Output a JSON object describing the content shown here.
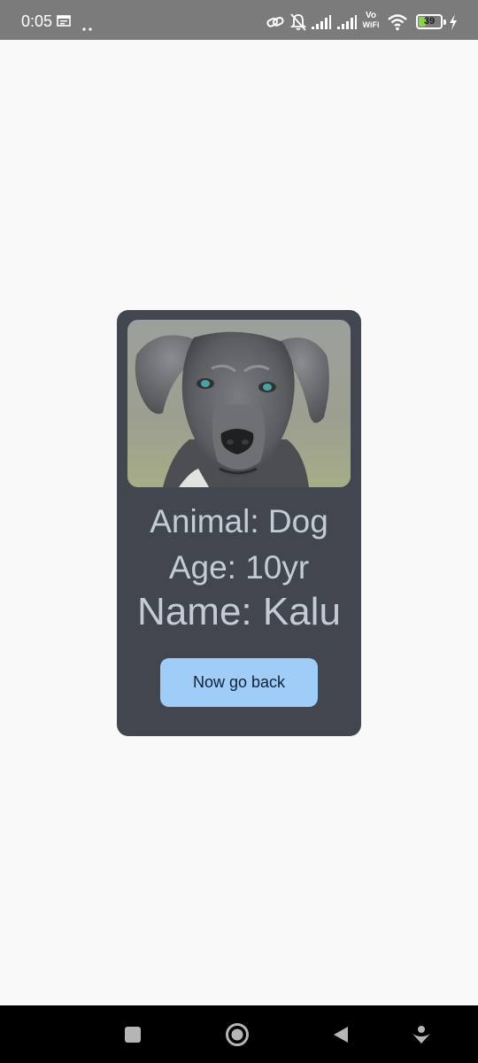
{
  "status_bar": {
    "time": "0:05",
    "battery": "39",
    "battery_level": 0.39,
    "vowifi_top": "Vo",
    "vowifi_bottom": "WiFi",
    "icons": [
      "calendar-icon",
      "more-dots-icon",
      "link-icon",
      "silent-bell-icon",
      "signal-icon",
      "signal-icon",
      "vowifi-icon",
      "wifi-icon",
      "battery-icon",
      "charging-icon"
    ]
  },
  "card": {
    "image": "dog-photo",
    "animal_line": "Animal: Dog",
    "age_line": "Age: 10yr",
    "name_line": "Name: Kalu",
    "button_label": "Now go back"
  },
  "nav_bar": {
    "icons": [
      "recents-icon",
      "home-icon",
      "back-icon",
      "assistant-icon"
    ]
  },
  "colors": {
    "background": "#f9f9f9",
    "card": "#42464f",
    "card_text": "#c4cbd6",
    "button": "#a0cdf8",
    "button_text": "#0e2236",
    "status_bar": "#7b7b7b",
    "nav_bar": "#000000"
  }
}
